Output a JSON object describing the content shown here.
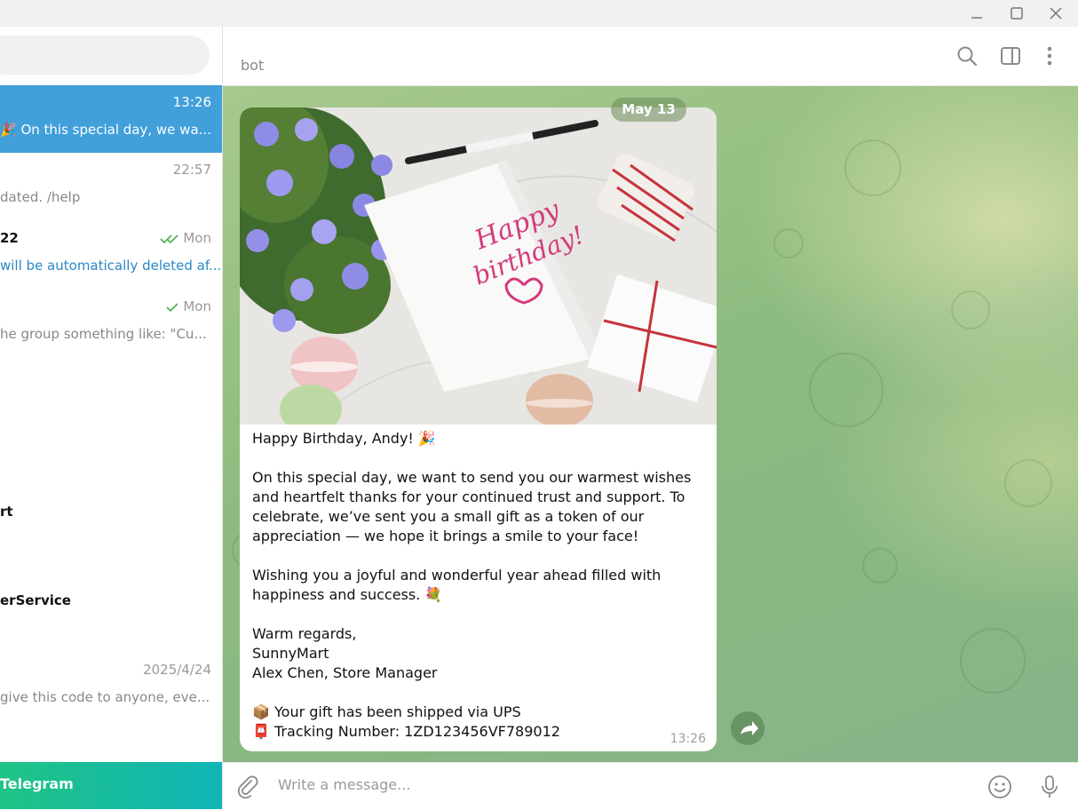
{
  "window": {
    "controls": [
      "minimize",
      "maximize",
      "close"
    ]
  },
  "sidebar": {
    "search_placeholder": "",
    "chats": [
      {
        "name": "",
        "time": "13:26",
        "preview": "On this special day, we wa...",
        "active": true
      },
      {
        "name": "",
        "time": "22:57",
        "preview": "dated. /help"
      },
      {
        "name": "22",
        "time": "Mon",
        "preview": "will be automatically deleted af...",
        "read": "double"
      },
      {
        "name": "",
        "time": "Mon",
        "preview": "he group something like:  \"Cu...",
        "read": "single"
      },
      {
        "name": "rt",
        "time": "",
        "preview": ""
      },
      {
        "name": "erService",
        "time": "",
        "preview": ""
      },
      {
        "name": "",
        "time": "2025/4/24",
        "preview": "give this code to anyone, eve..."
      }
    ],
    "banner": "Telegram"
  },
  "header": {
    "title": "bot",
    "icons": [
      "search-icon",
      "sidebar-toggle-icon",
      "more-icon"
    ]
  },
  "messages": {
    "date_badge": "May 13",
    "bubble": {
      "text": "Happy Birthday, Andy! 🎉\n\nOn this special day, we want to send you our warmest wishes and heartfelt thanks for your continued trust and support. To celebrate, we’ve sent you a small gift as a token of our appreciation — we hope it brings a smile to your face!\n\nWishing you a joyful and wonderful year ahead filled with happiness and success. 💐\n\nWarm regards,\nSunnyMart\nAlex Chen, Store Manager\n\n📦 Your gift has been shipped via UPS\n📮 Tracking Number: 1ZD123456VF789012",
      "time": "13:26",
      "photo_caption": "Happy birthday!"
    }
  },
  "composer": {
    "placeholder": "Write a message...",
    "icons": [
      "attach-icon",
      "emoji-icon",
      "microphone-icon"
    ]
  },
  "colors": {
    "active_chat": "#419fd9",
    "banner_start": "#1fc484",
    "banner_end": "#10b4b7",
    "chat_bg": "#8dbb7f"
  }
}
